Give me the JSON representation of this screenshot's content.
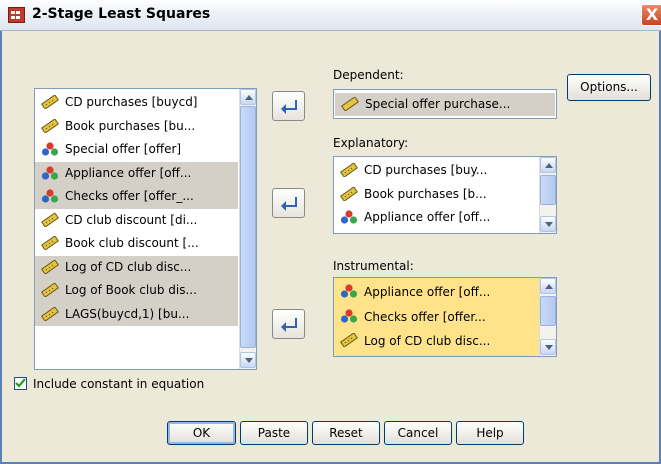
{
  "window": {
    "title": "2-Stage Least Squares",
    "close_glyph": "X"
  },
  "source_list": {
    "items": [
      {
        "label": "CD purchases [buycd]",
        "icon": "scale-ruler-icon",
        "selected": false
      },
      {
        "label": "Book purchases [bu...",
        "icon": "scale-ruler-icon",
        "selected": false
      },
      {
        "label": "Special offer [offer]",
        "icon": "nominal-circles-icon",
        "selected": false
      },
      {
        "label": "Appliance offer [off...",
        "icon": "nominal-circles-icon",
        "selected": true
      },
      {
        "label": "Checks offer [offer_...",
        "icon": "nominal-circles-icon",
        "selected": true
      },
      {
        "label": "CD club discount [di...",
        "icon": "scale-ruler-icon",
        "selected": false
      },
      {
        "label": "Book club discount [...",
        "icon": "scale-ruler-icon",
        "selected": false
      },
      {
        "label": "Log of CD club disc...",
        "icon": "scale-ruler-icon",
        "selected": true
      },
      {
        "label": "Log of Book club dis...",
        "icon": "scale-ruler-icon",
        "selected": true
      },
      {
        "label": "LAGS(buycd,1) [bu...",
        "icon": "scale-ruler-icon",
        "selected": true
      }
    ]
  },
  "dependent": {
    "label": "Dependent:",
    "value": "Special offer purchase..."
  },
  "explanatory": {
    "label": "Explanatory:",
    "items": [
      {
        "label": "CD purchases [buy...",
        "icon": "scale-ruler-icon"
      },
      {
        "label": "Book purchases [b...",
        "icon": "scale-ruler-icon"
      },
      {
        "label": "Appliance offer [off...",
        "icon": "nominal-circles-icon"
      }
    ]
  },
  "instrumental": {
    "label": "Instrumental:",
    "items": [
      {
        "label": "Appliance offer [off...",
        "icon": "nominal-circles-icon"
      },
      {
        "label": "Checks offer [offer...",
        "icon": "nominal-circles-icon"
      },
      {
        "label": "Log of CD club disc...",
        "icon": "scale-ruler-icon"
      }
    ]
  },
  "options_button": "Options...",
  "include_constant": {
    "label": "Include constant in equation",
    "checked": true
  },
  "buttons": {
    "ok": "OK",
    "paste": "Paste",
    "reset": "Reset",
    "cancel": "Cancel",
    "help": "Help"
  },
  "colors": {
    "selection": "#d4d0c8",
    "highlight": "#ffe38a",
    "arrow": "#2e63b6",
    "dialog": "#ece9d8"
  }
}
